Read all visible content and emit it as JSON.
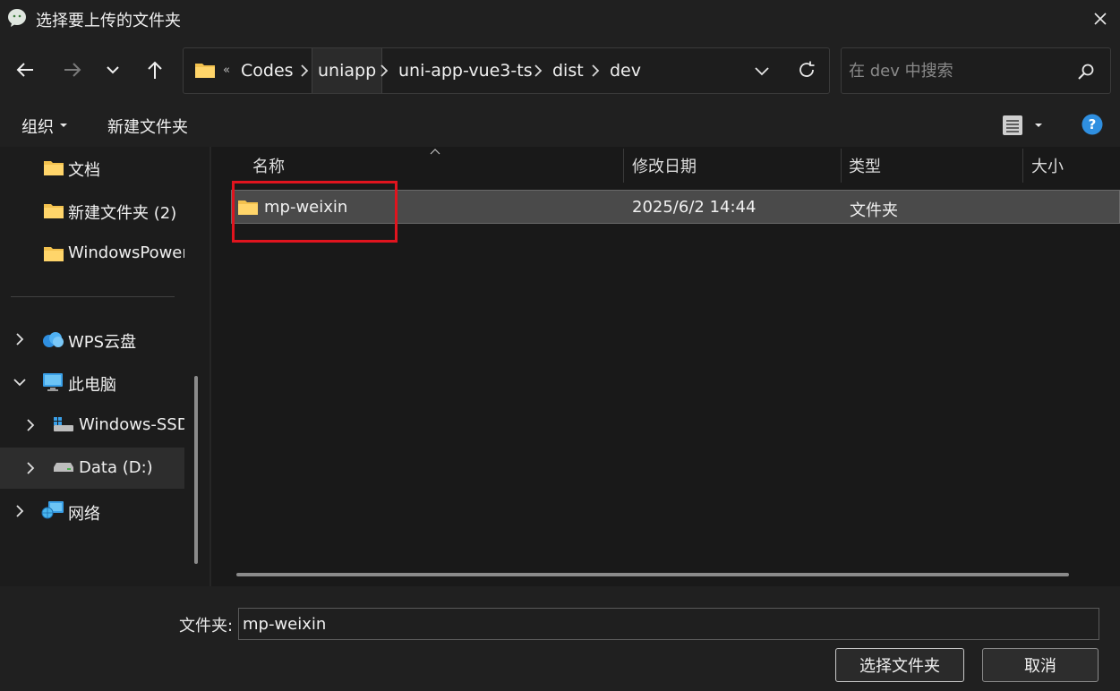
{
  "window": {
    "title": "选择要上传的文件夹"
  },
  "nav": {
    "breadcrumbs": [
      "Codes",
      "uniapp",
      "uni-app-vue3-ts",
      "dist",
      "dev"
    ],
    "overflow": "«",
    "search_placeholder": "在 dev 中搜索"
  },
  "commands": {
    "organize": "组织",
    "new_folder": "新建文件夹"
  },
  "sidebar": {
    "quick": [
      "文档",
      "新建文件夹 (2)",
      "WindowsPowerShell"
    ],
    "wps": "WPS云盘",
    "pc": "此电脑",
    "drives": [
      "Windows-SSD",
      "Data (D:)"
    ],
    "network": "网络"
  },
  "columns": {
    "name": "名称",
    "modified": "修改日期",
    "type": "类型",
    "size": "大小"
  },
  "files": [
    {
      "name": "mp-weixin",
      "modified": "2025/6/2 14:44",
      "type": "文件夹"
    }
  ],
  "footer": {
    "folder_label": "文件夹:",
    "folder_value": "mp-weixin",
    "select_button": "选择文件夹",
    "cancel_button": "取消"
  },
  "colors": {
    "folder": "#f2c14e",
    "accent": "#2f8fe0",
    "highlight": "#e0141e"
  }
}
